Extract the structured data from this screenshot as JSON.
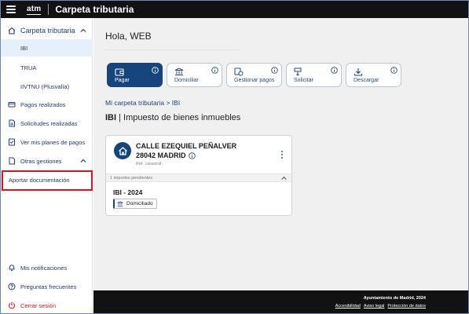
{
  "header": {
    "logo": "atm",
    "title": "Carpeta tributaria"
  },
  "sidebar": {
    "section_label": "Carpeta tributaria",
    "sub_items": [
      "IBI",
      "TRUA",
      "IIVTNU (Plusvalía)"
    ],
    "items": [
      {
        "label": "Pagos realizados",
        "icon": "payments-icon"
      },
      {
        "label": "Solicitudes realizadas",
        "icon": "requests-icon"
      },
      {
        "label": "Ver mis planes de pagos",
        "icon": "payment-plan-icon"
      }
    ],
    "other_label": "Otras gestiones",
    "other_sub": "Aportar documentación",
    "bottom": [
      {
        "label": "Mis notificaciones",
        "icon": "bell-icon"
      },
      {
        "label": "Preguntas frecuentes",
        "icon": "question-icon"
      },
      {
        "label": "Cerrar sesión",
        "icon": "power-icon"
      }
    ]
  },
  "main": {
    "greeting": "Hola, WEB",
    "actions": [
      {
        "label": "Pagar",
        "icon": "wallet-icon"
      },
      {
        "label": "Domiciliar",
        "icon": "bank-icon"
      },
      {
        "label": "Gestionar pagos",
        "icon": "manage-payments-icon"
      },
      {
        "label": "Solicitar",
        "icon": "request-icon"
      },
      {
        "label": "Descargar",
        "icon": "download-icon"
      }
    ],
    "breadcrumb": "Mi carpeta tributaria > IBI",
    "page_title_code": "IBI",
    "page_title_sep": "|",
    "page_title_desc": "Impuesto de bienes inmuebles",
    "card": {
      "address_line1": "CALLE EZEQUIEL PEÑALVER",
      "address_line2": "28042 MADRID",
      "ref_label": "Ref. catastral:",
      "pending": "1 importes pendientes",
      "tax_year": "IBI - 2024",
      "status_badge": "Domiciliado"
    }
  },
  "footer": {
    "org": "Ayuntamiento de Madrid, 2024",
    "links": [
      "Accesibilidad",
      "Aviso legal",
      "Protección de datos"
    ]
  },
  "colors": {
    "primary": "#16447d",
    "topbar": "#121212",
    "highlight": "#e1101d",
    "logout": "#d7141a"
  }
}
